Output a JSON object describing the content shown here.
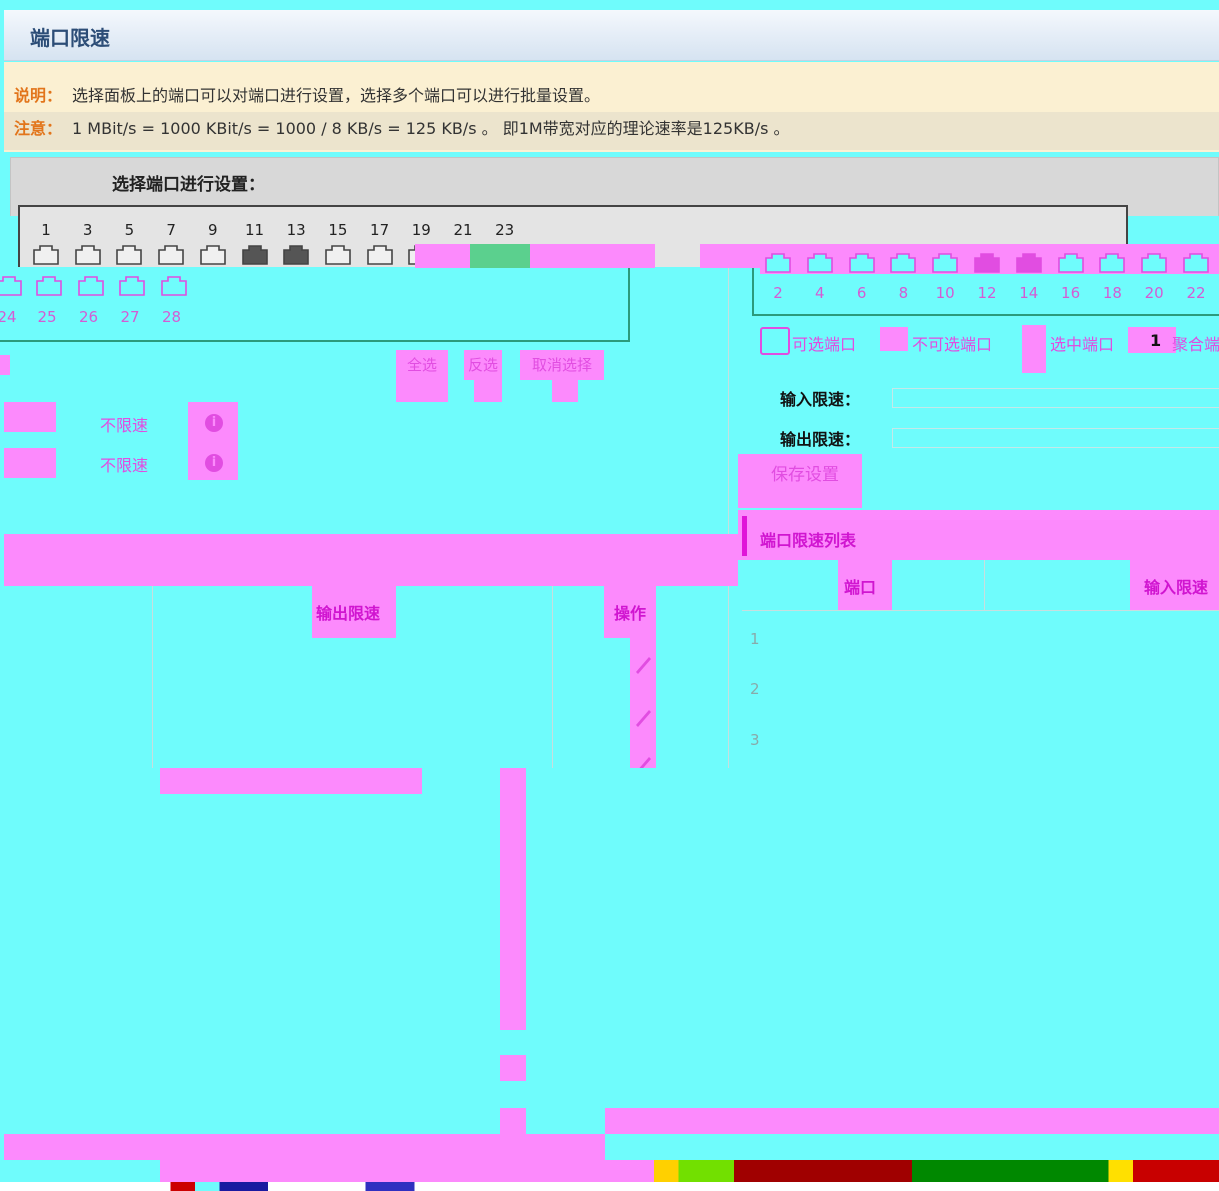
{
  "header": {
    "title": "端口限速"
  },
  "notice": {
    "line1_label": "说明：",
    "line1_text": "选择面板上的端口可以对端口进行设置，选择多个端口可以进行批量设置。",
    "line2_label": "注意：",
    "line2_text": "1 MBit/s = 1000 KBit/s = 1000 / 8 KB/s = 125 KB/s 。 即1M带宽对应的理论速率是125KB/s 。"
  },
  "panel": {
    "title": "选择端口进行设置：",
    "top_port_numbers": [
      "1",
      "3",
      "5",
      "7",
      "9",
      "11",
      "13",
      "15",
      "17",
      "19",
      "21",
      "23"
    ],
    "bottom_port_numbers": [
      "2",
      "4",
      "6",
      "8",
      "10",
      "12",
      "14",
      "16",
      "18",
      "20",
      "22"
    ],
    "left_port_numbers": [
      "24",
      "25",
      "26",
      "27",
      "28"
    ]
  },
  "legend": {
    "selectable": "可选端口",
    "unselectable": "不可选端口",
    "selected": "选中端口",
    "aggregate": "聚合端"
  },
  "buttons": {
    "select_all": "全选",
    "invert": "反选",
    "cancel_select": "取消选择",
    "save": "保存设置"
  },
  "left_summary": {
    "row1": "不限速",
    "row2": "不限速"
  },
  "form": {
    "input_limit_label": "输入限速：",
    "output_limit_label": "输出限速："
  },
  "list": {
    "title": "端口限速列表",
    "col_port": "端口",
    "col_input": "输入限速",
    "col_output": "输出限速",
    "col_action": "操作",
    "rows": [
      "1",
      "2",
      "3"
    ]
  },
  "colors": {
    "background": "#6ffcfc",
    "glitch_magenta": "#fc8afc",
    "header_text": "#2c4d77",
    "notice_label": "#e2751b"
  }
}
